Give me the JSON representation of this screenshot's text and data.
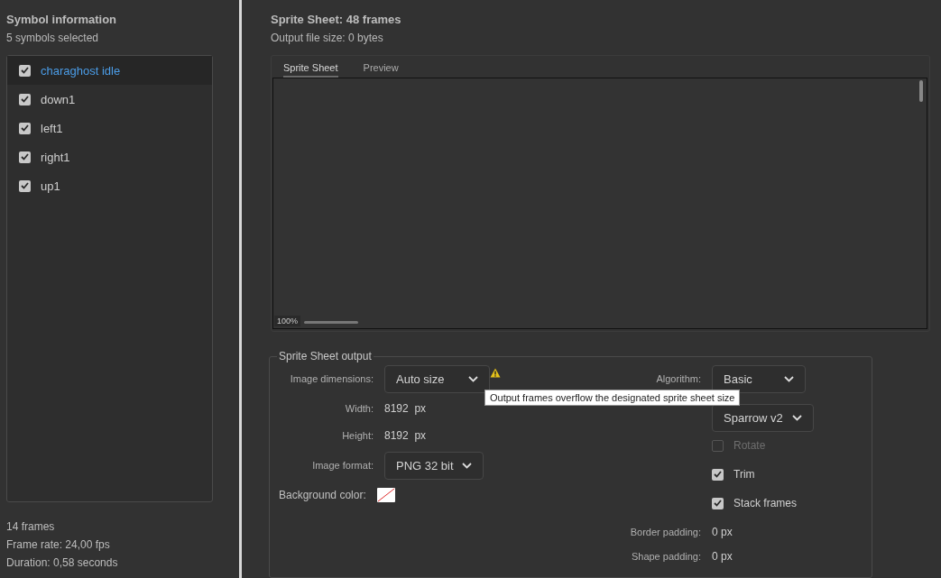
{
  "symbol_panel": {
    "title": "Symbol information",
    "subtitle": "5 symbols selected",
    "symbols": [
      {
        "name": "charaghost idle",
        "checked": true,
        "selected": true
      },
      {
        "name": "down1",
        "checked": true,
        "selected": false
      },
      {
        "name": "left1",
        "checked": true,
        "selected": false
      },
      {
        "name": "right1",
        "checked": true,
        "selected": false
      },
      {
        "name": "up1",
        "checked": true,
        "selected": false
      }
    ],
    "stats": [
      "14 frames",
      "Frame rate: 24,00 fps",
      "Duration: 0,58 seconds"
    ]
  },
  "sprite_sheet": {
    "title": "Sprite Sheet: 48 frames",
    "file_size": "Output file size: 0 bytes",
    "tabs": [
      {
        "label": "Sprite Sheet",
        "selected": true
      },
      {
        "label": "Preview",
        "selected": false
      }
    ],
    "zoom": "100%"
  },
  "output": {
    "legend": "Sprite Sheet output",
    "image_dimensions": {
      "label": "Image dimensions:",
      "value": "Auto size",
      "warning": true
    },
    "width": {
      "label": "Width:",
      "value": "8192",
      "unit": "px"
    },
    "height": {
      "label": "Height:",
      "value": "8192",
      "unit": "px"
    },
    "image_format": {
      "label": "Image format:",
      "value": "PNG 32 bit"
    },
    "background_color": {
      "label": "Background color:"
    },
    "algorithm": {
      "label": "Algorithm:",
      "value": "Basic"
    },
    "data_format": {
      "value": "Sparrow v2"
    },
    "options": [
      {
        "label": "Rotate",
        "checked": false,
        "disabled": true
      },
      {
        "label": "Trim",
        "checked": true,
        "disabled": false
      },
      {
        "label": "Stack frames",
        "checked": true,
        "disabled": false
      }
    ],
    "border_padding": {
      "label": "Border padding:",
      "value": "0",
      "unit": "px"
    },
    "shape_padding": {
      "label": "Shape padding:",
      "value": "0",
      "unit": "px"
    },
    "tooltip": "Output frames overflow the designated sprite sheet size"
  }
}
